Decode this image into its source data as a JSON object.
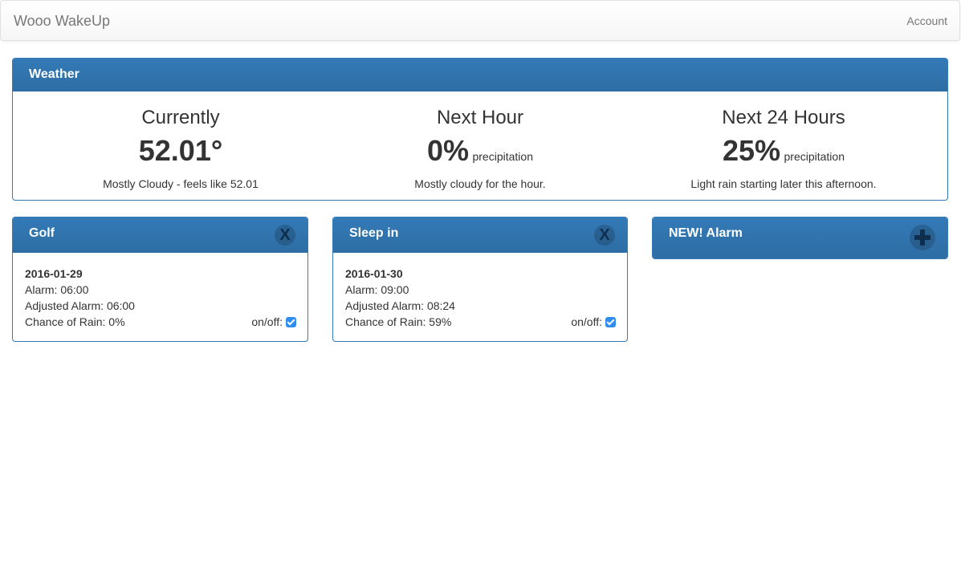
{
  "navbar": {
    "brand": "Wooo WakeUp",
    "account": "Account"
  },
  "weather": {
    "heading": "Weather",
    "columns": [
      {
        "title": "Currently",
        "value": "52.01°",
        "unit": "",
        "desc": "Mostly Cloudy - feels like 52.01"
      },
      {
        "title": "Next Hour",
        "value": "0%",
        "unit": "precipitation",
        "desc": "Mostly cloudy for the hour."
      },
      {
        "title": "Next 24 Hours",
        "value": "25%",
        "unit": "precipitation",
        "desc": "Light rain starting later this afternoon."
      }
    ]
  },
  "alarms": [
    {
      "name": "Golf",
      "close": "X",
      "date": "2016-01-29",
      "alarm": "Alarm: 06:00",
      "adjusted": "Adjusted Alarm: 06:00",
      "rain": "Chance of Rain: 0%",
      "onoff": "on/off:",
      "enabled": true
    },
    {
      "name": "Sleep in",
      "close": "X",
      "date": "2016-01-30",
      "alarm": "Alarm: 09:00",
      "adjusted": "Adjusted Alarm: 08:24",
      "rain": "Chance of Rain: 59%",
      "onoff": "on/off:",
      "enabled": true
    }
  ],
  "new_alarm": {
    "label": "NEW! Alarm",
    "icon": "plus-icon"
  },
  "colors": {
    "primary": "#337ab7",
    "checkbox": "#2f8ef0"
  }
}
